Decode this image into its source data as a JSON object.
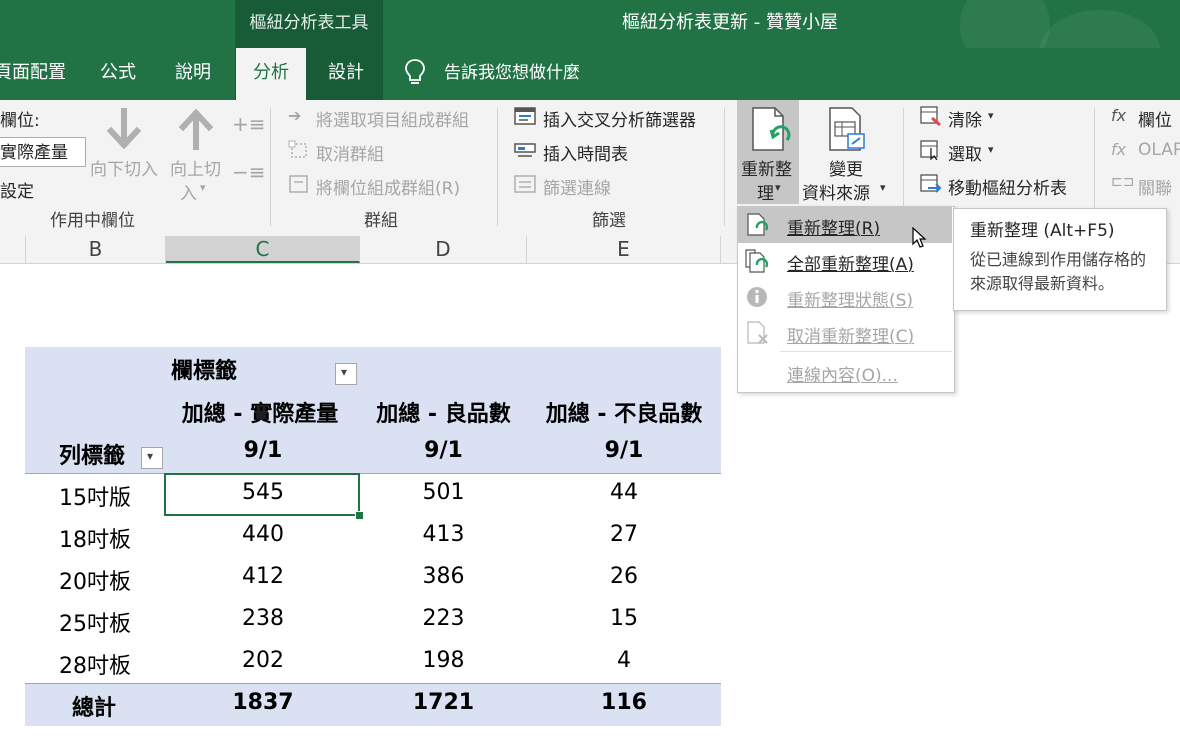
{
  "window": {
    "context_group": "樞紐分析表工具",
    "title": "樞紐分析表更新 - 贊贊小屋"
  },
  "tabs": [
    {
      "label": "頁面配置"
    },
    {
      "label": "公式"
    },
    {
      "label": "說明"
    },
    {
      "label": "分析"
    },
    {
      "label": "設計"
    }
  ],
  "tell_me": "告訴我您想做什麼",
  "ribbon": {
    "active_field": {
      "label": "欄位:",
      "value": "實際產量",
      "settings": "設定",
      "drill_down": "向下切入",
      "drill_up_1": "向上切",
      "drill_up_2": "入",
      "group_label": "作用中欄位"
    },
    "group": {
      "group_selection": "將選取項目組成群組",
      "ungroup": "取消群組",
      "group_field": "將欄位組成群組(R)",
      "group_label": "群組"
    },
    "filter": {
      "insert_slicer": "插入交叉分析篩選器",
      "insert_timeline": "插入時間表",
      "filter_connections": "篩選連線",
      "group_label": "篩選"
    },
    "data": {
      "refresh_1": "重新整",
      "refresh_2": "理",
      "change_source_1": "變更",
      "change_source_2": "資料來源"
    },
    "actions": {
      "clear": "清除",
      "select": "選取",
      "move": "移動樞紐分析表"
    },
    "calc": {
      "fields": "欄位",
      "olap": "OLAP",
      "relationships": "關聯"
    }
  },
  "columns": [
    "B",
    "C",
    "D",
    "E"
  ],
  "pivot": {
    "col_labels": "欄標籤",
    "row_labels": "列標籤",
    "measures": [
      "加總 - 實際產量",
      "加總 - 良品數",
      "加總 - 不良品數"
    ],
    "dates": [
      "9/1",
      "9/1",
      "9/1"
    ],
    "rows": [
      {
        "label": "15吋版",
        "values": [
          "545",
          "501",
          "44"
        ]
      },
      {
        "label": "18吋板",
        "values": [
          "440",
          "413",
          "27"
        ]
      },
      {
        "label": "20吋板",
        "values": [
          "412",
          "386",
          "26"
        ]
      },
      {
        "label": "25吋板",
        "values": [
          "238",
          "223",
          "15"
        ]
      },
      {
        "label": "28吋板",
        "values": [
          "202",
          "198",
          "4"
        ]
      }
    ],
    "total": {
      "label": "總計",
      "values": [
        "1837",
        "1721",
        "116"
      ]
    }
  },
  "refresh_menu": [
    {
      "label": "重新整理(R)",
      "highlighted": true,
      "disabled": false
    },
    {
      "label": "全部重新整理(A)",
      "highlighted": false,
      "disabled": false
    },
    {
      "label": "重新整理狀態(S)",
      "highlighted": false,
      "disabled": true
    },
    {
      "label": "取消重新整理(C)",
      "highlighted": false,
      "disabled": true
    },
    {
      "label": "連線內容(O)...",
      "highlighted": false,
      "disabled": true
    }
  ],
  "tooltip": {
    "title": "重新整理 (Alt+F5)",
    "description": "從已連線到作用儲存格的來源取得最新資料。"
  },
  "colors": {
    "excel_green": "#217346",
    "context_green": "#185c37",
    "pivot_header": "#d9e1f2",
    "menu_highlight": "#c6c6c6"
  }
}
